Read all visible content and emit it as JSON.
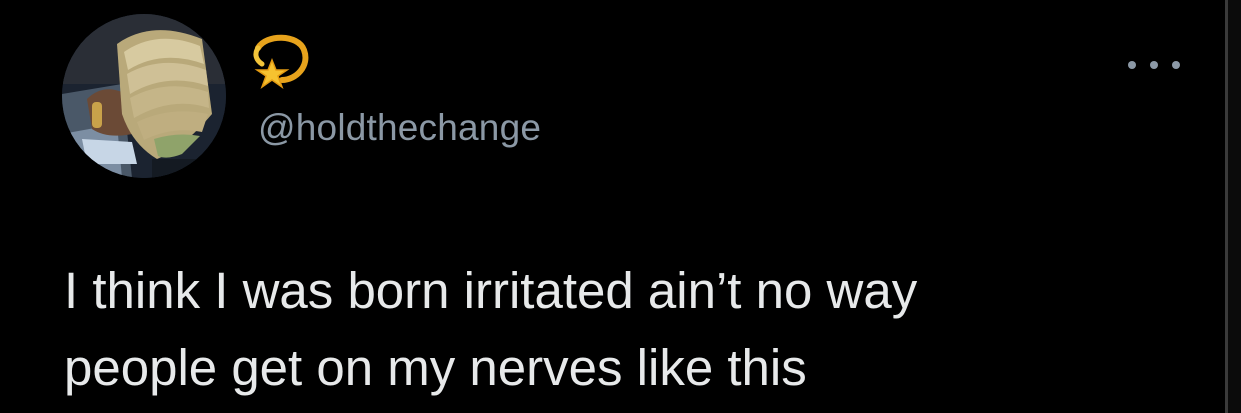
{
  "tweet": {
    "display_name_icon": "dizzy-star-emoji-icon",
    "handle": "@holdthechange",
    "text_line_1": "I think I was born irritated ain’t no way",
    "text_line_2": "people get on my nerves like this",
    "more_icon": "more-options-icon"
  },
  "colors": {
    "background": "#000000",
    "text": "#e7e9ea",
    "secondary_text": "#8b98a5"
  }
}
